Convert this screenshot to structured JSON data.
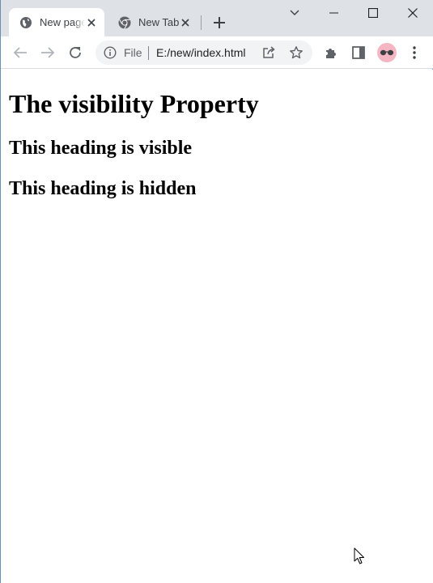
{
  "browser": {
    "tabs": [
      {
        "title": "New page",
        "icon": "globe-icon",
        "active": true
      },
      {
        "title": "New Tab",
        "icon": "chrome-icon",
        "active": false
      }
    ],
    "omnibox": {
      "scheme_label": "File",
      "url": "E:/new/index.html"
    }
  },
  "page": {
    "heading": "The visibility Property",
    "visible_heading": "This heading is visible",
    "hidden_heading": "This heading is hidden"
  }
}
